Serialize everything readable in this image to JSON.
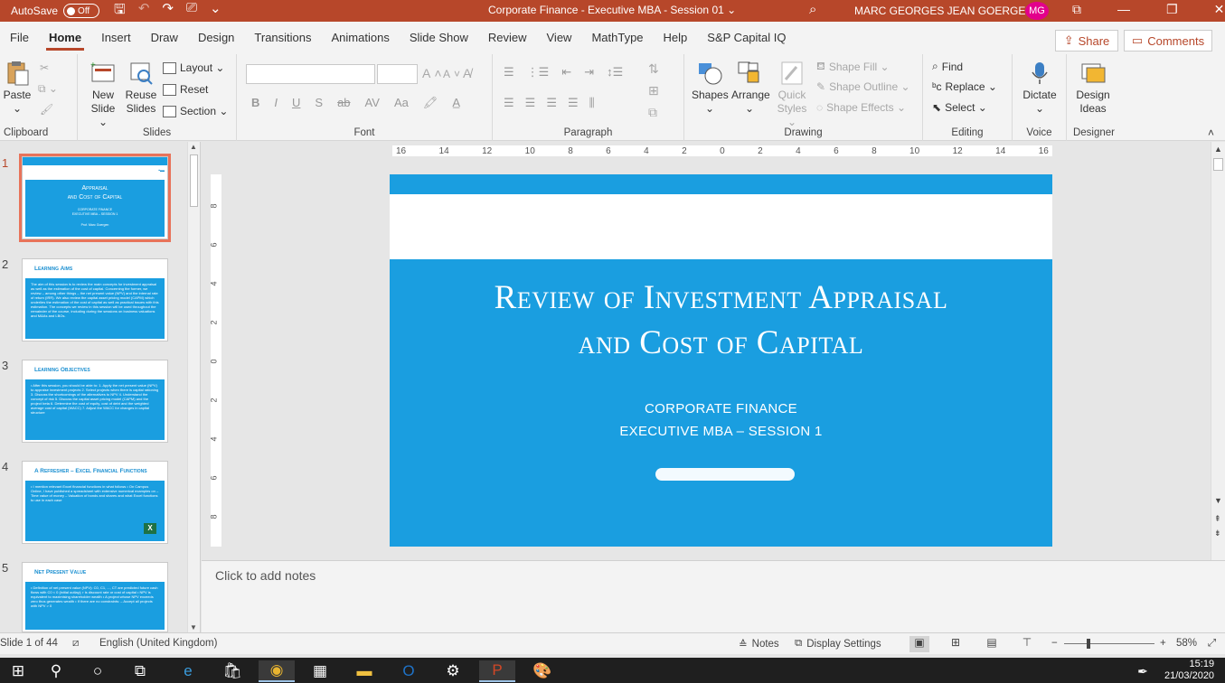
{
  "window": {
    "autosave_label": "AutoSave",
    "autosave_state": "Off",
    "title": "Corporate Finance - Executive MBA - Session 01",
    "title_chevron": "⌄",
    "user_name": "MARC GEORGES JEAN GOERGEN .",
    "user_initials": "MG"
  },
  "menu": {
    "tabs": [
      "File",
      "Home",
      "Insert",
      "Draw",
      "Design",
      "Transitions",
      "Animations",
      "Slide Show",
      "Review",
      "View",
      "MathType",
      "Help",
      "S&P Capital IQ"
    ],
    "active_tab": "Home",
    "share_label": "Share",
    "comments_label": "Comments"
  },
  "ribbon": {
    "clipboard": {
      "label": "Clipboard",
      "paste": "Paste"
    },
    "slides": {
      "label": "Slides",
      "new_slide": "New\nSlide",
      "new_slide_l1": "New",
      "new_slide_l2": "Slide ⌄",
      "reuse_l1": "Reuse",
      "reuse_l2": "Slides",
      "layout": "Layout ⌄",
      "reset": "Reset",
      "section": "Section ⌄"
    },
    "font": {
      "label": "Font",
      "bold": "B",
      "italic": "I",
      "underline": "U",
      "strike": "S",
      "strike_abc": "ab",
      "spacing": "AV",
      "case": "Aa",
      "grow": "A",
      "shrink": "A"
    },
    "paragraph": {
      "label": "Paragraph"
    },
    "drawing": {
      "label": "Drawing",
      "shapes": "Shapes",
      "arrange": "Arrange",
      "quick_styles_l1": "Quick",
      "quick_styles_l2": "Styles ⌄",
      "shape_fill": "Shape Fill ⌄",
      "shape_outline": "Shape Outline ⌄",
      "shape_effects": "Shape Effects ⌄"
    },
    "editing": {
      "label": "Editing",
      "find": "Find",
      "replace": "Replace ⌄",
      "select": "Select ⌄"
    },
    "voice": {
      "label": "Voice",
      "dictate": "Dictate"
    },
    "designer": {
      "label": "Designer",
      "design_ideas_l1": "Design",
      "design_ideas_l2": "Ideas"
    }
  },
  "thumbnails": [
    {
      "num": "1",
      "title_l1": "Appraisal",
      "title_l2": "and Cost of Capital",
      "sub_l1": "CORPORATE FINANCE",
      "sub_l2": "EXECUTIVE MBA – SESSION 1",
      "author": "Prof. Marc Goergen"
    },
    {
      "num": "2",
      "head": "Learning Aims",
      "body": "The aim of this session is to review the main concepts for investment appraisal as well as the estimation of the cost of capital. Concerning the former, we review – among other things – the net present value (NPV) and the internal rate of return (IRR). We also review the capital asset pricing model (CAPM) which underlies the estimation of the cost of capital as well as practical issues with this estimation. The concepts we review in this session will be used throughout the remainder of the course, including during the sessions on business valuations and M&As and LBOs."
    },
    {
      "num": "3",
      "head": "Learning Objectives",
      "body": "• After this session, you should be able to: 1. Apply the net present value (NPV) to appraise investment projects 2. Select projects when there is capital rationing 3. Discuss the shortcomings of the alternatives to NPV 4. Understand the concept of risk 5. Discuss the capital asset pricing model (CAPM) and the project beta 6. Determine the cost of equity, cost of debt and the weighted average cost of capital (WACC) 7. Adjust the WACC for changes in capital structure"
    },
    {
      "num": "4",
      "head": "A Refresher – Excel Financial Functions",
      "body": "• I mention relevant Excel financial functions in what follows • On Campus Online, I have published a spreadsheet with extensive numerical examples on – Time value of money – Valuation of bonds and shares and what Excel functions to use in each case"
    },
    {
      "num": "5",
      "head": "Net Present Value",
      "body": "• Definition of net present value (NPV): C0, C1, ..., CT are predicted future cash flows with C0 < 0 (initial outlay); r is discount rate or cost of capital • NPV is equivalent to maximising shareholder wealth • A project whose NPV exceeds zero thus generates wealth • If there are no constraints: – Accept all projects with NPV > 0"
    }
  ],
  "ruler": {
    "h_ticks": [
      "16",
      "14",
      "12",
      "10",
      "8",
      "6",
      "4",
      "2",
      "0",
      "2",
      "4",
      "6",
      "8",
      "10",
      "12",
      "14",
      "16"
    ],
    "v_ticks": [
      "8",
      "6",
      "4",
      "2",
      "0",
      "2",
      "4",
      "6",
      "8"
    ]
  },
  "slide": {
    "title_l1": "Review of Investment Appraisal",
    "title_l2": "and Cost of Capital",
    "subtitle_l1": "CORPORATE FINANCE",
    "subtitle_l2": "EXECUTIVE MBA – SESSION 1"
  },
  "notes": {
    "placeholder": "Click to add notes"
  },
  "status": {
    "slide_counter": "Slide 1 of 44",
    "language": "English (United Kingdom)",
    "notes": "Notes",
    "display_settings": "Display Settings",
    "zoom_minus": "−",
    "zoom_plus": "+",
    "zoom": "58%"
  },
  "taskbar": {
    "time": "15:19",
    "date": "21/03/2020"
  },
  "colors": {
    "accent": "#b7472a",
    "slide_blue": "#1a9ee0",
    "avatar": "#e3008c"
  }
}
